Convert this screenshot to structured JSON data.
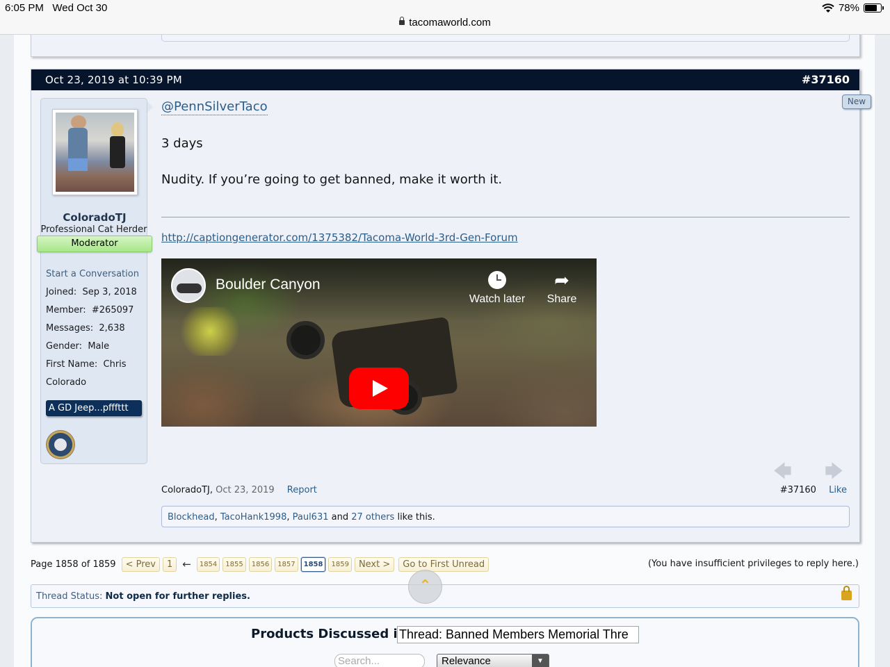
{
  "status_bar": {
    "time": "6:05 PM",
    "date": "Wed Oct 30",
    "battery": "78%",
    "battery_level": 0.78,
    "url": "tacomaworld.com"
  },
  "post": {
    "date": "Oct 23, 2019 at 10:39 PM",
    "number": "#37160",
    "new_badge": "New",
    "user": {
      "name": "ColoradoTJ",
      "title": "Professional Cat Herder",
      "banner": "Moderator",
      "start_conversation": "Start a Conversation",
      "info": [
        {
          "label": "Joined:",
          "value": "Sep 3, 2018"
        },
        {
          "label": "Member:",
          "value": "#265097"
        },
        {
          "label": "Messages:",
          "value": "2,638"
        },
        {
          "label": "Gender:",
          "value": "Male"
        },
        {
          "label": "First Name:",
          "value": "Chris"
        }
      ],
      "location": "Colorado",
      "vehicle": "A GD Jeep...pfffttt"
    },
    "mention": "@PennSilverTaco",
    "lines": [
      "3 days",
      "Nudity. If you’re going to get banned, make it worth it."
    ],
    "signature_link": "http://captiongenerator.com/1375382/Tacoma-World-3rd-Gen-Forum",
    "video": {
      "title": "Boulder Canyon",
      "watch_later": "Watch later",
      "share": "Share"
    },
    "meta": {
      "author": "ColoradoTJ",
      "date": "Oct 23, 2019",
      "report": "Report",
      "permalink": "#37160",
      "like": "Like"
    },
    "likes": {
      "users": [
        "Blockhead",
        "TacoHank1998",
        "Paul631"
      ],
      "sep": ", ",
      "and": " and ",
      "others": "27 others",
      "tail": " like this."
    }
  },
  "pagination": {
    "label": "Page 1858 of 1859",
    "prev": "< Prev",
    "first": "1",
    "ellipsis": "←",
    "pages": [
      "1854",
      "1855",
      "1856",
      "1857",
      "1858",
      "1859"
    ],
    "current": "1858",
    "next": "Next >",
    "first_unread": "Go to First Unread",
    "no_reply": "(You have insufficient privileges to reply here.)"
  },
  "thread_status": {
    "label": "Thread Status:",
    "value": "Not open for further replies."
  },
  "products": {
    "title": "Products Discussed in",
    "thread": "Thread: Banned Members Memorial Thre",
    "search_placeholder": "Search...",
    "sort": "Relevance"
  }
}
